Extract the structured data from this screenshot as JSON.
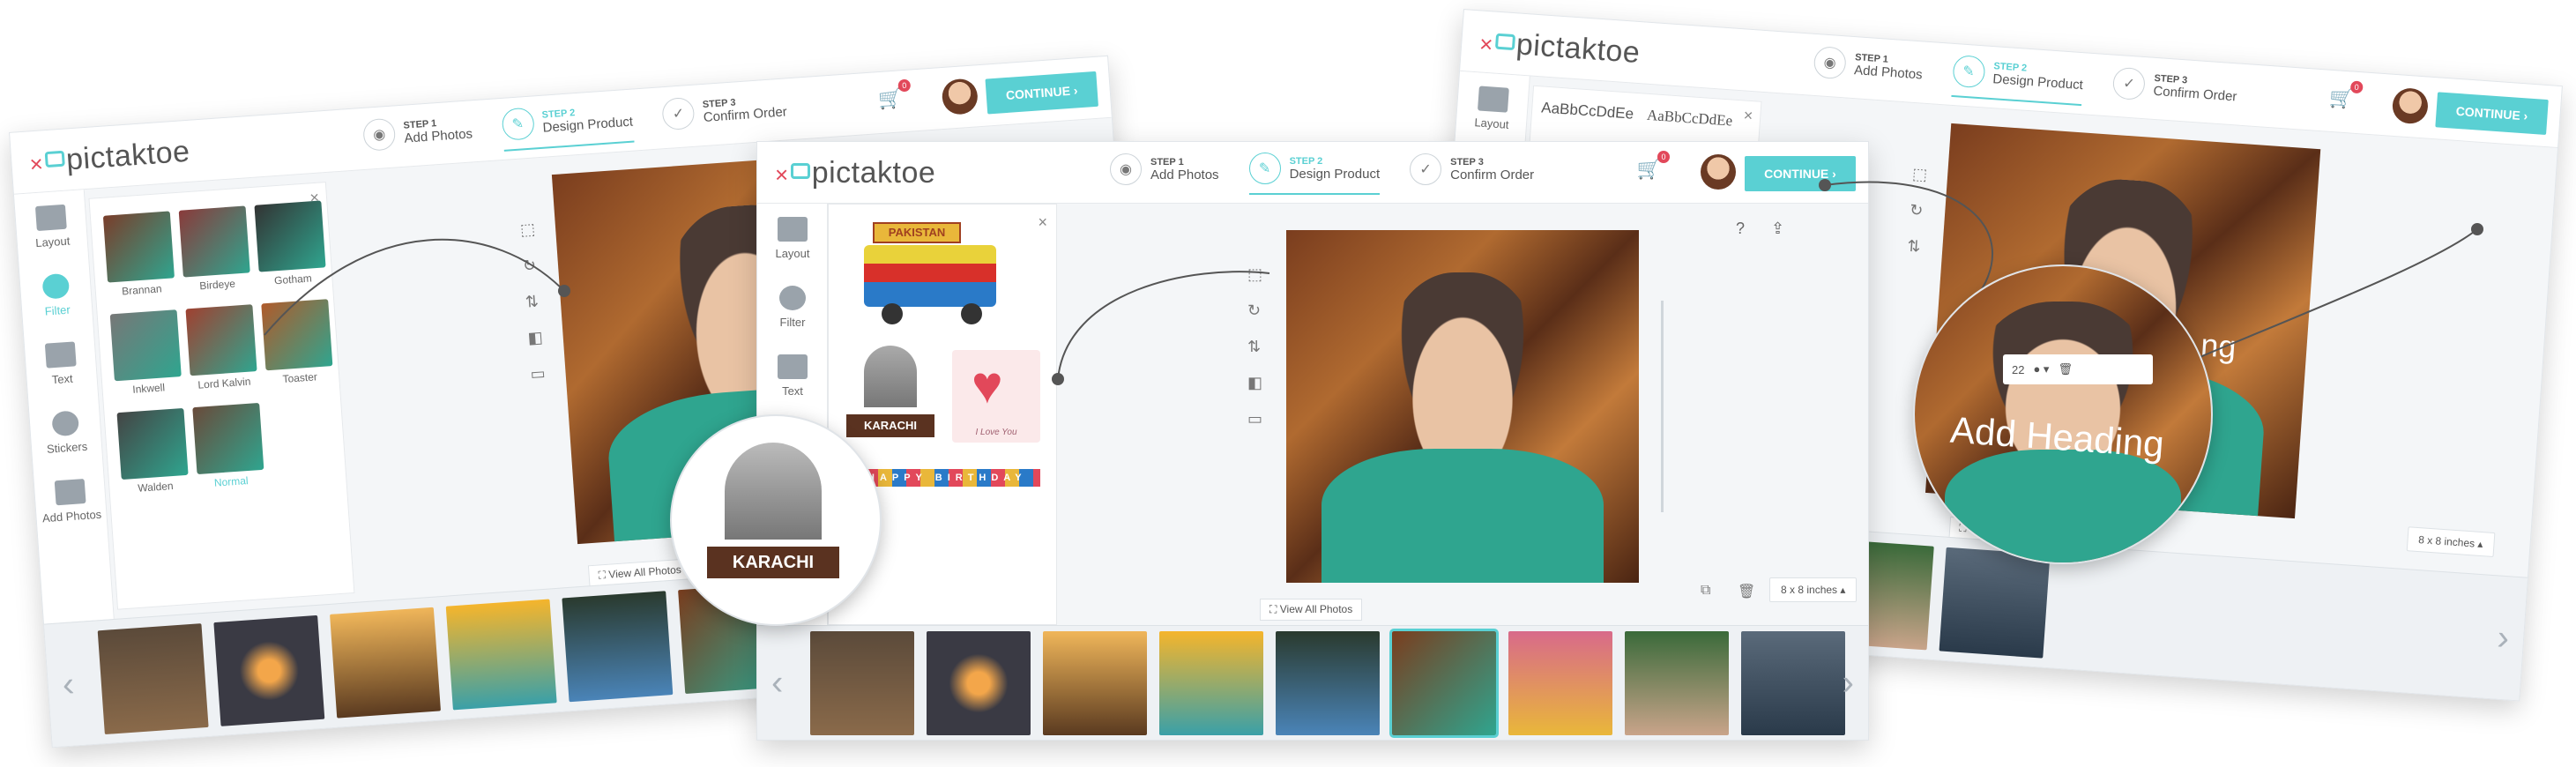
{
  "brand": "pictaktoe",
  "steps": [
    {
      "num": "STEP 1",
      "name": "Add Photos"
    },
    {
      "num": "STEP 2",
      "name": "Design Product"
    },
    {
      "num": "STEP 3",
      "name": "Confirm Order"
    }
  ],
  "cart_count": "0",
  "continue_label": "CONTINUE",
  "sidebar_left": [
    "Layout",
    "Filter",
    "Text",
    "Stickers",
    "Add Photos"
  ],
  "sidebar_center": [
    "Layout",
    "Filter",
    "Text"
  ],
  "sidebar_right": [
    "Layout"
  ],
  "filters": [
    "Brannan",
    "Birdeye",
    "Gotham",
    "Inkwell",
    "Lord Kalvin",
    "Toaster",
    "Walden",
    "Normal"
  ],
  "stickers": {
    "truck_text": "PAKISTAN",
    "karachi": "KARACHI",
    "heart_caption": "I Love You",
    "banner_text": "HAPPY BIRTHDAY"
  },
  "fonts_sample": [
    "AaBbCcDdEe",
    "AaBbCcDdEe"
  ],
  "view_all": "View All Photos",
  "size": "8 x 8 inches",
  "heading_text": "Add Heading",
  "heading_text_partial": "ng",
  "font_size": "22",
  "colors": {
    "accent": "#5ad0d3",
    "badge": "#e2485a"
  }
}
